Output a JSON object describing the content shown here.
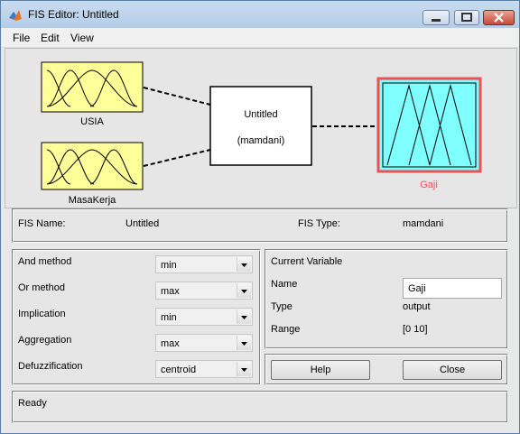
{
  "window": {
    "title": "FIS Editor: Untitled"
  },
  "menu": [
    "File",
    "Edit",
    "View"
  ],
  "inputs": [
    {
      "name": "USIA"
    },
    {
      "name": "MasaKerja"
    }
  ],
  "system": {
    "name": "Untitled",
    "type_label": "(mamdani)"
  },
  "output": {
    "name": "Gaji"
  },
  "info": {
    "fis_name_label": "FIS Name:",
    "fis_name": "Untitled",
    "fis_type_label": "FIS Type:",
    "fis_type": "mamdani"
  },
  "methods": [
    {
      "label": "And method",
      "value": "min"
    },
    {
      "label": "Or method",
      "value": "max"
    },
    {
      "label": "Implication",
      "value": "min"
    },
    {
      "label": "Aggregation",
      "value": "max"
    },
    {
      "label": "Defuzzification",
      "value": "centroid"
    }
  ],
  "current_variable": {
    "heading": "Current Variable",
    "name_label": "Name",
    "name_value": "Gaji",
    "type_label": "Type",
    "type_value": "output",
    "range_label": "Range",
    "range_value": "[0 10]"
  },
  "buttons": {
    "help": "Help",
    "close": "Close"
  },
  "status": "Ready",
  "colors": {
    "input_block": "#ffff99",
    "output_block": "#80ffff",
    "selected_border": "#f05050",
    "selected_text": "#f05050"
  }
}
